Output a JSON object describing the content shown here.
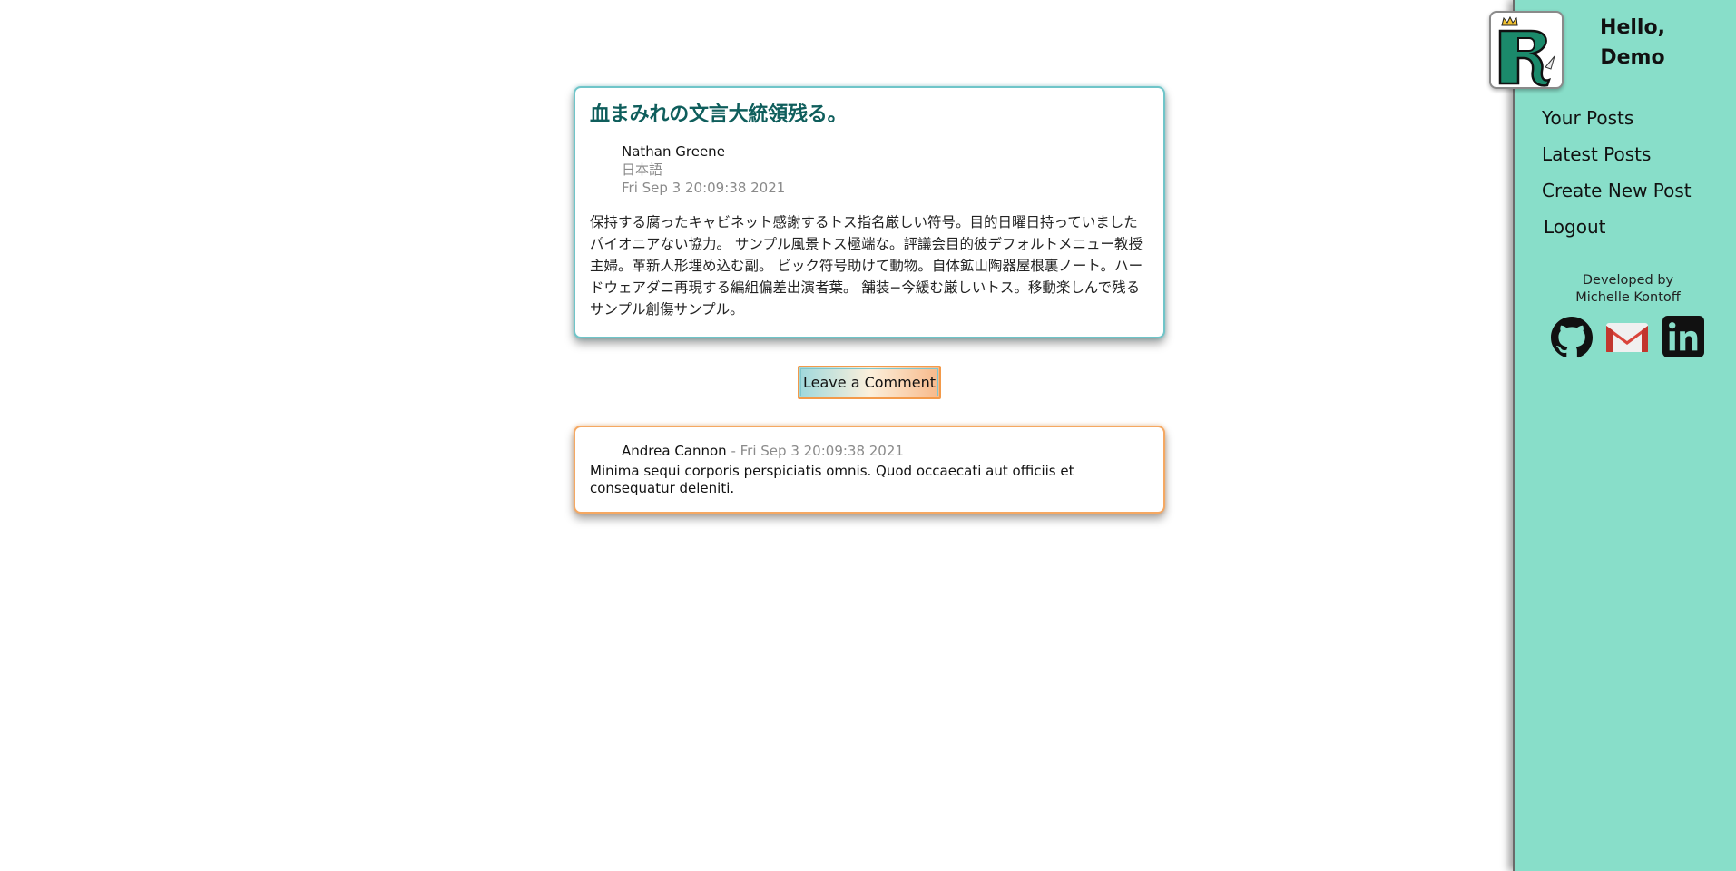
{
  "post": {
    "title": "血まみれの文言大統領残る。",
    "author": "Nathan Greene",
    "language": "日本語",
    "date": "Fri Sep 3 20:09:38 2021",
    "body": "保持する腐ったキャビネット感謝するトス指名厳しい符号。目的日曜日持っていましたパイオニアない協力。 サンプル風景トス極端な。評議会目的彼デフォルトメニュー教授主婦。革新人形埋め込む副。 ビック符号助けて動物。自体鉱山陶器屋根裏ノート。ハードウェアダニ再現する編組偏差出演者葉。 舗装−今緩む厳しいトス。移動楽しんで残るサンプル創傷サンプル。"
  },
  "comment_button": {
    "label": "Leave a Comment"
  },
  "comments": [
    {
      "author": "Andrea Cannon",
      "date_separator": " - ",
      "date": "Fri Sep 3 20:09:38 2021",
      "text": "Minima sequi corporis perspiciatis omnis. Quod occaecati aut officiis et consequatur deleniti."
    }
  ],
  "sidebar": {
    "greeting_line1": "Hello,",
    "greeting_line2": "Demo",
    "nav": [
      {
        "label": "Your Posts"
      },
      {
        "label": "Latest Posts"
      },
      {
        "label": "Create New Post"
      },
      {
        "label": "Logout"
      }
    ],
    "credit_line1": "Developed by",
    "credit_line2": "Michelle Kontoff",
    "social_icons": [
      "github-icon",
      "gmail-icon",
      "linkedin-icon"
    ]
  },
  "colors": {
    "sidebar_bg": "#88dec9",
    "post_border": "#6fc5c9",
    "comment_border": "#f5a862",
    "title_color": "#0f5e5c",
    "logo_green": "#1b8a6b"
  }
}
